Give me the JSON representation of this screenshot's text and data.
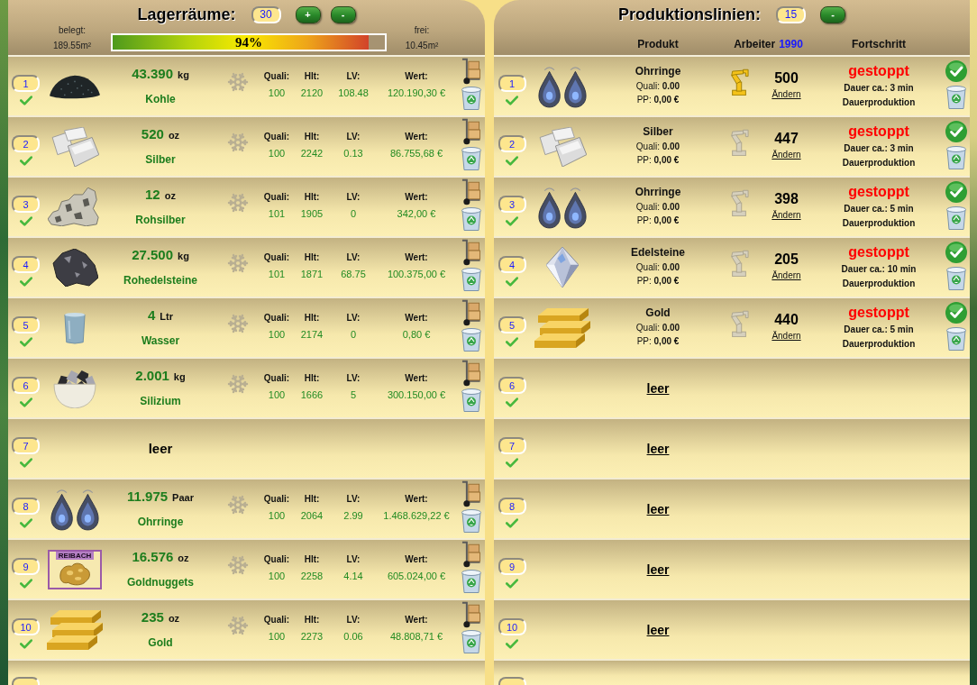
{
  "storage": {
    "title": "Lagerräume:",
    "count": "30",
    "buttons": [
      "+",
      "-"
    ],
    "used": {
      "label": "belegt:",
      "value": "189.55m²"
    },
    "capacity": {
      "level": 0.94,
      "label": "94%"
    },
    "free": {
      "label": "frei:",
      "value": "10.45m²"
    },
    "rows": [
      {
        "number": "1",
        "ok": true,
        "kind": "item",
        "amount": "43.390",
        "unit": "kg",
        "name": "Kohle",
        "stats": [
          {
            "label": "Quali:",
            "value": "100"
          },
          {
            "label": "Hlt:",
            "value": "2120"
          },
          {
            "label": "LV:",
            "value": "108.48"
          },
          {
            "label": "Wert:",
            "value": "120.190,30 €"
          }
        ]
      },
      {
        "number": "2",
        "ok": true,
        "kind": "item",
        "amount": "520",
        "unit": "oz",
        "name": "Silber",
        "stats": [
          {
            "label": "Quali:",
            "value": "100"
          },
          {
            "label": "Hlt:",
            "value": "2242"
          },
          {
            "label": "LV:",
            "value": "0.13"
          },
          {
            "label": "Wert:",
            "value": "86.755,68 €"
          }
        ]
      },
      {
        "number": "3",
        "ok": true,
        "kind": "item",
        "amount": "12",
        "unit": "oz",
        "name": "Rohsilber",
        "stats": [
          {
            "label": "Quali:",
            "value": "101"
          },
          {
            "label": "Hlt:",
            "value": "1905"
          },
          {
            "label": "LV:",
            "value": "0"
          },
          {
            "label": "Wert:",
            "value": "342,00 €"
          }
        ]
      },
      {
        "number": "4",
        "ok": true,
        "kind": "item",
        "amount": "27.500",
        "unit": "kg",
        "name": "Rohedelsteine",
        "stats": [
          {
            "label": "Quali:",
            "value": "101"
          },
          {
            "label": "Hlt:",
            "value": "1871"
          },
          {
            "label": "LV:",
            "value": "68.75"
          },
          {
            "label": "Wert:",
            "value": "100.375,00 €"
          }
        ]
      },
      {
        "number": "5",
        "ok": true,
        "kind": "item",
        "amount": "4",
        "unit": "Ltr",
        "name": "Wasser",
        "stats": [
          {
            "label": "Quali:",
            "value": "100"
          },
          {
            "label": "Hlt:",
            "value": "2174"
          },
          {
            "label": "LV:",
            "value": "0"
          },
          {
            "label": "Wert:",
            "value": "0,80 €"
          }
        ]
      },
      {
        "number": "6",
        "ok": true,
        "kind": "item",
        "amount": "2.001",
        "unit": "kg",
        "name": "Silizium",
        "stats": [
          {
            "label": "Quali:",
            "value": "100"
          },
          {
            "label": "Hlt:",
            "value": "1666"
          },
          {
            "label": "LV:",
            "value": "5"
          },
          {
            "label": "Wert:",
            "value": "300.150,00 €"
          }
        ]
      },
      {
        "number": "7",
        "ok": true,
        "kind": "empty",
        "text": "leer"
      },
      {
        "number": "8",
        "ok": true,
        "kind": "item",
        "amount": "11.975",
        "unit": "Paar",
        "name": "Ohrringe",
        "stats": [
          {
            "label": "Quali:",
            "value": "100"
          },
          {
            "label": "Hlt:",
            "value": "2064"
          },
          {
            "label": "LV:",
            "value": "2.99"
          },
          {
            "label": "Wert:",
            "value": "1.468.629,22 €"
          }
        ]
      },
      {
        "number": "9",
        "ok": true,
        "kind": "item",
        "image_tag": "REIBACH",
        "amount": "16.576",
        "unit": "oz",
        "name": "Goldnuggets",
        "stats": [
          {
            "label": "Quali:",
            "value": "100"
          },
          {
            "label": "Hlt:",
            "value": "2258"
          },
          {
            "label": "LV:",
            "value": "4.14"
          },
          {
            "label": "Wert:",
            "value": "605.024,00 €"
          }
        ]
      },
      {
        "number": "10",
        "ok": true,
        "kind": "item",
        "amount": "235",
        "unit": "oz",
        "name": "Gold",
        "stats": [
          {
            "label": "Quali:",
            "value": "100"
          },
          {
            "label": "Hlt:",
            "value": "2273"
          },
          {
            "label": "LV:",
            "value": "0.06"
          },
          {
            "label": "Wert:",
            "value": "48.808,71 €"
          }
        ]
      }
    ],
    "more_rows_below": true
  },
  "production": {
    "title": "Produktionslinien:",
    "count": "15",
    "buttons": [
      "-"
    ],
    "columns": [
      {
        "label": "Produkt",
        "kind": "product"
      },
      {
        "label": "Arbeiter",
        "extra": "1990",
        "kind": "workers"
      },
      {
        "label": "Fortschritt",
        "kind": "progress"
      }
    ],
    "rows": [
      {
        "number": "1",
        "ok": true,
        "kind": "line",
        "product": "Ohrringe",
        "quality": "Quali: **0.00**",
        "price": "PP: **0,00 €**",
        "worker_active": true,
        "workers": "500",
        "change": "Ändern",
        "status": "gestoppt",
        "duration": "Dauer ca.: 3 min",
        "mode": "Dauerproduktion"
      },
      {
        "number": "2",
        "ok": true,
        "kind": "line",
        "product": "Silber",
        "quality": "Quali: **0.00**",
        "price": "PP: **0,00 €**",
        "worker_active": false,
        "workers": "447",
        "change": "Ändern",
        "status": "gestoppt",
        "duration": "Dauer ca.: 3 min",
        "mode": "Dauerproduktion"
      },
      {
        "number": "3",
        "ok": true,
        "kind": "line",
        "product": "Ohrringe",
        "quality": "Quali: **0.00**",
        "price": "PP: **0,00 €**",
        "worker_active": false,
        "workers": "398",
        "change": "Ändern",
        "status": "gestoppt",
        "duration": "Dauer ca.: 5 min",
        "mode": "Dauerproduktion"
      },
      {
        "number": "4",
        "ok": true,
        "kind": "line",
        "product": "Edelsteine",
        "quality": "Quali: **0.00**",
        "price": "PP: **0,00 €**",
        "worker_active": false,
        "workers": "205",
        "change": "Ändern",
        "status": "gestoppt",
        "duration": "Dauer ca.: 10 min",
        "mode": "Dauerproduktion"
      },
      {
        "number": "5",
        "ok": true,
        "kind": "line",
        "product": "Gold",
        "quality": "Quali: **0.00**",
        "price": "PP: **0,00 €**",
        "worker_active": false,
        "workers": "440",
        "change": "Ändern",
        "status": "gestoppt",
        "duration": "Dauer ca.: 5 min",
        "mode": "Dauerproduktion"
      },
      {
        "number": "6",
        "ok": true,
        "kind": "empty",
        "text": "leer"
      },
      {
        "number": "7",
        "ok": true,
        "kind": "empty",
        "text": "leer"
      },
      {
        "number": "8",
        "ok": true,
        "kind": "empty",
        "text": "leer"
      },
      {
        "number": "9",
        "ok": true,
        "kind": "empty",
        "text": "leer"
      },
      {
        "number": "10",
        "ok": true,
        "kind": "empty",
        "text": "leer"
      }
    ],
    "more_rows_below": true
  }
}
